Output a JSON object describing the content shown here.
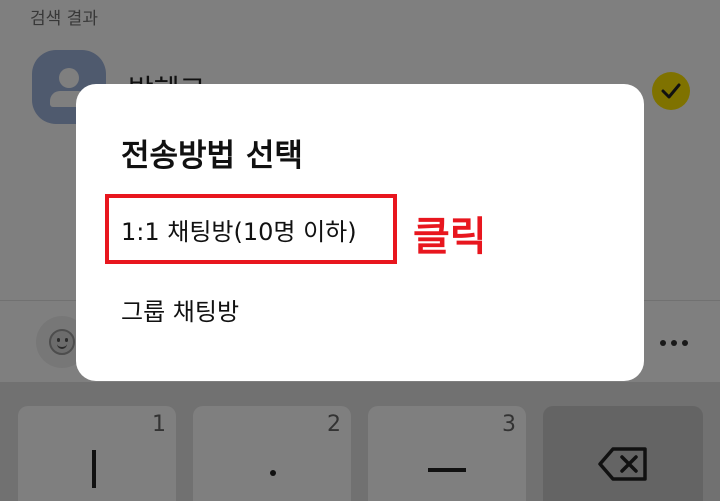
{
  "background": {
    "section_label": "검색 결과",
    "contact": {
      "name": "박혜교",
      "avatar_icon": "person-icon",
      "selected_icon": "checkmark-icon"
    },
    "input_bar": {
      "emoji_icon": "emoji-icon",
      "more_icon": "more-dots-icon"
    },
    "keyboard": {
      "keys": [
        {
          "number": "1",
          "glyph": "ㅣ"
        },
        {
          "number": "2",
          "glyph": "·"
        },
        {
          "number": "3",
          "glyph": "ㅡ"
        },
        {
          "icon": "backspace-icon"
        }
      ]
    }
  },
  "dialog": {
    "title": "전송방법 선택",
    "options": [
      {
        "label": "1:1 채팅방(10명 이하)"
      },
      {
        "label": "그룹 채팅방"
      }
    ]
  },
  "annotation": {
    "text": "클릭",
    "color": "#e8161e"
  },
  "colors": {
    "accent": "#fee500",
    "highlight": "#e8161e"
  }
}
